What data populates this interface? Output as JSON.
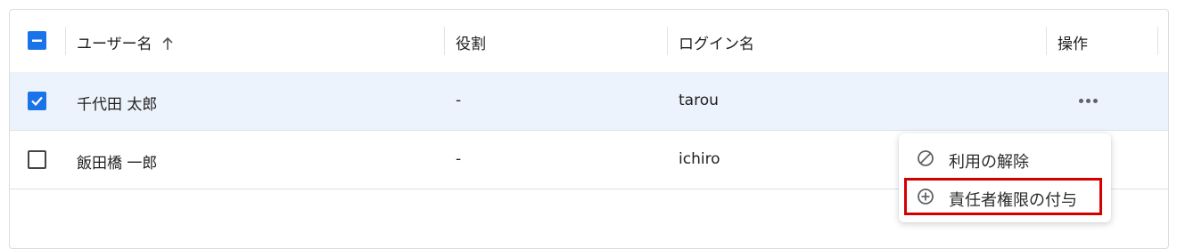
{
  "table": {
    "columns": {
      "username": "ユーザー名",
      "role": "役割",
      "login": "ログイン名",
      "actions": "操作"
    },
    "rows": [
      {
        "selected": true,
        "username": "千代田 太郎",
        "role": "-",
        "login": "tarou"
      },
      {
        "selected": false,
        "username": "飯田橋 一郎",
        "role": "-",
        "login": "ichiro"
      }
    ]
  },
  "context_menu": {
    "items": [
      {
        "label": "利用の解除",
        "icon": "block-icon"
      },
      {
        "label": "責任者権限の付与",
        "icon": "add-circle-icon"
      }
    ]
  },
  "colors": {
    "accent": "#1a73e8",
    "selected_row": "#edf3fc",
    "highlight": "#d40000"
  }
}
